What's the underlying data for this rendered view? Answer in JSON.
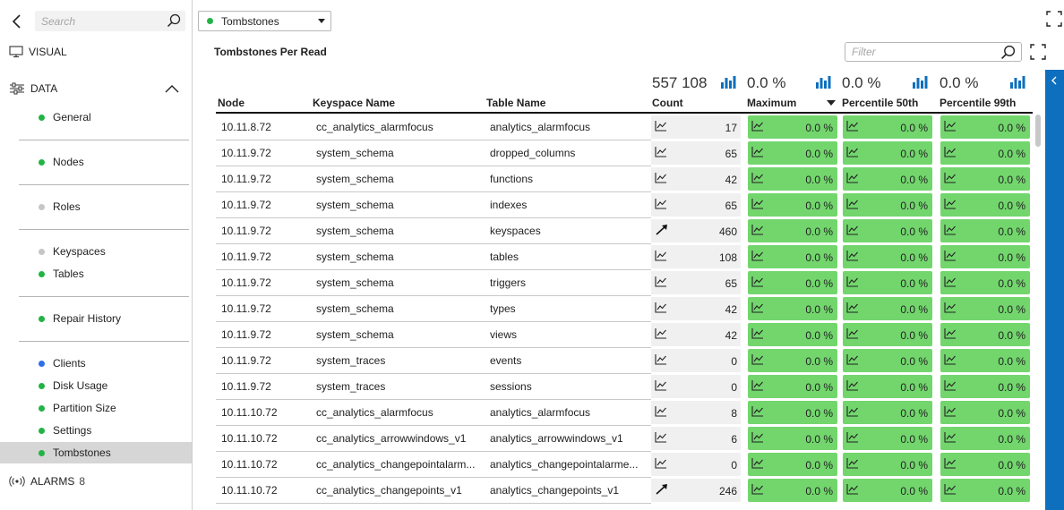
{
  "sidebar": {
    "search_placeholder": "Search",
    "visual_label": "VISUAL",
    "data_label": "DATA",
    "alarms_label": "ALARMS",
    "alarms_count": "8",
    "items": [
      {
        "label": "General",
        "status": "#22b345"
      },
      {
        "label": "Nodes",
        "status": "#22b345"
      },
      {
        "label": "Roles",
        "status": "#c6c6c6"
      },
      {
        "label": "Keyspaces",
        "status": "#c6c6c6"
      },
      {
        "label": "Tables",
        "status": "#22b345"
      },
      {
        "label": "Repair History",
        "status": "#22b345"
      },
      {
        "label": "Clients",
        "status": "#2f6fea"
      },
      {
        "label": "Disk Usage",
        "status": "#22b345"
      },
      {
        "label": "Partition Size",
        "status": "#22b345"
      },
      {
        "label": "Settings",
        "status": "#22b345"
      },
      {
        "label": "Tombstones",
        "status": "#22b345"
      }
    ],
    "active_item": "Tombstones"
  },
  "header": {
    "dropdown_label": "Tombstones",
    "dropdown_status": "#22b345"
  },
  "panel": {
    "title": "Tombstones Per Read",
    "filter_placeholder": "Filter"
  },
  "summary": {
    "count": "557 108",
    "maximum": "0.0 %",
    "p50": "0.0 %",
    "p99": "0.0 %"
  },
  "table": {
    "columns": [
      "Node",
      "Keyspace Name",
      "Table Name",
      "Count",
      "Maximum",
      "Percentile 50th",
      "Percentile 99th"
    ],
    "sorted_column": "Maximum",
    "rows": [
      {
        "node": "10.11.8.72",
        "keyspace": "cc_analytics_alarmfocus",
        "table": "analytics_alarmfocus",
        "trend": "flat",
        "count": "17",
        "max": "0.0 %",
        "p50": "0.0 %",
        "p99": "0.0 %"
      },
      {
        "node": "10.11.9.72",
        "keyspace": "system_schema",
        "table": "dropped_columns",
        "trend": "flat",
        "count": "65",
        "max": "0.0 %",
        "p50": "0.0 %",
        "p99": "0.0 %"
      },
      {
        "node": "10.11.9.72",
        "keyspace": "system_schema",
        "table": "functions",
        "trend": "flat",
        "count": "42",
        "max": "0.0 %",
        "p50": "0.0 %",
        "p99": "0.0 %"
      },
      {
        "node": "10.11.9.72",
        "keyspace": "system_schema",
        "table": "indexes",
        "trend": "flat",
        "count": "65",
        "max": "0.0 %",
        "p50": "0.0 %",
        "p99": "0.0 %"
      },
      {
        "node": "10.11.9.72",
        "keyspace": "system_schema",
        "table": "keyspaces",
        "trend": "up",
        "count": "460",
        "max": "0.0 %",
        "p50": "0.0 %",
        "p99": "0.0 %"
      },
      {
        "node": "10.11.9.72",
        "keyspace": "system_schema",
        "table": "tables",
        "trend": "flat",
        "count": "108",
        "max": "0.0 %",
        "p50": "0.0 %",
        "p99": "0.0 %"
      },
      {
        "node": "10.11.9.72",
        "keyspace": "system_schema",
        "table": "triggers",
        "trend": "flat",
        "count": "65",
        "max": "0.0 %",
        "p50": "0.0 %",
        "p99": "0.0 %"
      },
      {
        "node": "10.11.9.72",
        "keyspace": "system_schema",
        "table": "types",
        "trend": "flat",
        "count": "42",
        "max": "0.0 %",
        "p50": "0.0 %",
        "p99": "0.0 %"
      },
      {
        "node": "10.11.9.72",
        "keyspace": "system_schema",
        "table": "views",
        "trend": "flat",
        "count": "42",
        "max": "0.0 %",
        "p50": "0.0 %",
        "p99": "0.0 %"
      },
      {
        "node": "10.11.9.72",
        "keyspace": "system_traces",
        "table": "events",
        "trend": "flat",
        "count": "0",
        "max": "0.0 %",
        "p50": "0.0 %",
        "p99": "0.0 %"
      },
      {
        "node": "10.11.9.72",
        "keyspace": "system_traces",
        "table": "sessions",
        "trend": "flat",
        "count": "0",
        "max": "0.0 %",
        "p50": "0.0 %",
        "p99": "0.0 %"
      },
      {
        "node": "10.11.10.72",
        "keyspace": "cc_analytics_alarmfocus",
        "table": "analytics_alarmfocus",
        "trend": "flat",
        "count": "8",
        "max": "0.0 %",
        "p50": "0.0 %",
        "p99": "0.0 %"
      },
      {
        "node": "10.11.10.72",
        "keyspace": "cc_analytics_arrowwindows_v1",
        "table": "analytics_arrowwindows_v1",
        "trend": "flat",
        "count": "6",
        "max": "0.0 %",
        "p50": "0.0 %",
        "p99": "0.0 %"
      },
      {
        "node": "10.11.10.72",
        "keyspace": "cc_analytics_changepointalarm...",
        "table": "analytics_changepointalarme...",
        "trend": "flat",
        "count": "0",
        "max": "0.0 %",
        "p50": "0.0 %",
        "p99": "0.0 %"
      },
      {
        "node": "10.11.10.72",
        "keyspace": "cc_analytics_changepoints_v1",
        "table": "analytics_changepoints_v1",
        "trend": "up",
        "count": "246",
        "max": "0.0 %",
        "p50": "0.0 %",
        "p99": "0.0 %"
      }
    ]
  },
  "colors": {
    "accent": "#0e6fbe",
    "metric_ok": "#72d66d",
    "chart_icon": "#0e6fbe"
  }
}
